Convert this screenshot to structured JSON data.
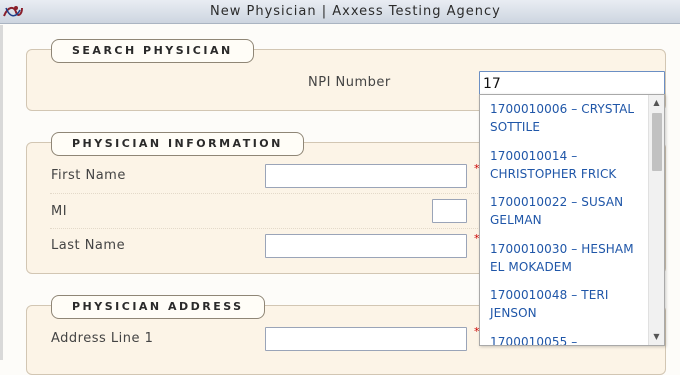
{
  "window": {
    "title": "New Physician | Axxess Testing Agency",
    "logo_icon": "axxess-logo-icon"
  },
  "search_section": {
    "legend": "Search Physician",
    "npi_label": "NPI Number",
    "npi_value": "17"
  },
  "info_section": {
    "legend": "Physician Information",
    "first_name_label": "First Name",
    "mi_label": "MI",
    "last_name_label": "Last Name",
    "required_mark": "*"
  },
  "address_section": {
    "legend": "Physician Address",
    "address1_label": "Address Line 1"
  },
  "autocomplete": {
    "items": [
      "1700010006 – CRYSTAL SOTTILE",
      "1700010014 – CHRISTOPHER FRICK",
      "1700010022 – SUSAN GELMAN",
      "1700010030 – HESHAM EL MOKADEM",
      "1700010048 – TERI JENSON",
      "1700010055 –"
    ],
    "scroll_up_icon": "▲",
    "scroll_down_icon": "▼"
  },
  "colors": {
    "section_bg": "#fcf4e7",
    "link_blue": "#1f56a8",
    "required_red": "#cc0000"
  }
}
